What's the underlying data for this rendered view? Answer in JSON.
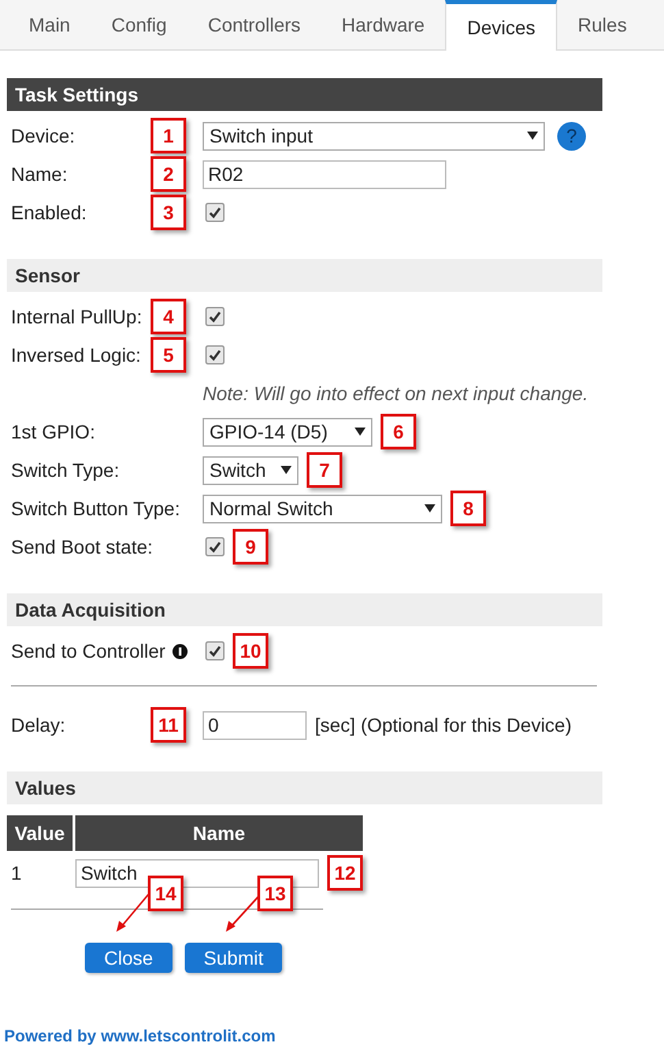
{
  "tabs": [
    {
      "label": "Main",
      "selected": false
    },
    {
      "label": "Config",
      "selected": false
    },
    {
      "label": "Controllers",
      "selected": false
    },
    {
      "label": "Hardware",
      "selected": false
    },
    {
      "label": "Devices",
      "selected": true
    },
    {
      "label": "Rules",
      "selected": false
    }
  ],
  "sections": [
    {
      "title": "Task Settings",
      "rows": [
        {
          "kind": "select",
          "label": "Device:",
          "value": "Switch input",
          "callout_before": "1",
          "help": "?"
        },
        {
          "kind": "text",
          "label": "Name:",
          "value": "R02",
          "callout_before": "2"
        },
        {
          "kind": "checkbox",
          "label": "Enabled:",
          "checked": true,
          "callout_before": "3"
        }
      ]
    },
    {
      "title": "Sensor",
      "rows": [
        {
          "kind": "checkbox",
          "label": "Internal PullUp:",
          "checked": true,
          "callout_before": "4"
        },
        {
          "kind": "checkbox",
          "label": "Inversed Logic:",
          "checked": true,
          "callout_before": "5"
        },
        {
          "kind": "note",
          "text": "Note: Will go into effect on next input change."
        },
        {
          "kind": "select",
          "label": "1st GPIO:",
          "value": "GPIO-14 (D5)",
          "callout_after": "6"
        },
        {
          "kind": "select",
          "label": "Switch Type:",
          "value": "Switch",
          "callout_after": "7"
        },
        {
          "kind": "select",
          "label": "Switch Button Type:",
          "value": "Normal Switch",
          "callout_after": "8"
        },
        {
          "kind": "checkbox",
          "label": "Send Boot state:",
          "checked": true,
          "callout_after": "9"
        }
      ]
    },
    {
      "title": "Data Acquisition",
      "rows": [
        {
          "kind": "checkbox",
          "label": "Send to Controller",
          "info": true,
          "checked": true,
          "callout_after": "10"
        },
        {
          "kind": "divider"
        },
        {
          "kind": "number",
          "label": "Delay:",
          "value": "0",
          "suffix": "[sec] (Optional for this Device)",
          "callout_before": "11"
        }
      ]
    }
  ],
  "values": {
    "title": "Values",
    "columns": [
      "Value",
      "Name"
    ],
    "rows": [
      {
        "value": "1",
        "name": "Switch",
        "callout": "12"
      }
    ]
  },
  "buttons": [
    {
      "label": "Close",
      "callout": "14"
    },
    {
      "label": "Submit",
      "callout": "13"
    }
  ],
  "footer": "Powered by www.letscontrolit.com"
}
